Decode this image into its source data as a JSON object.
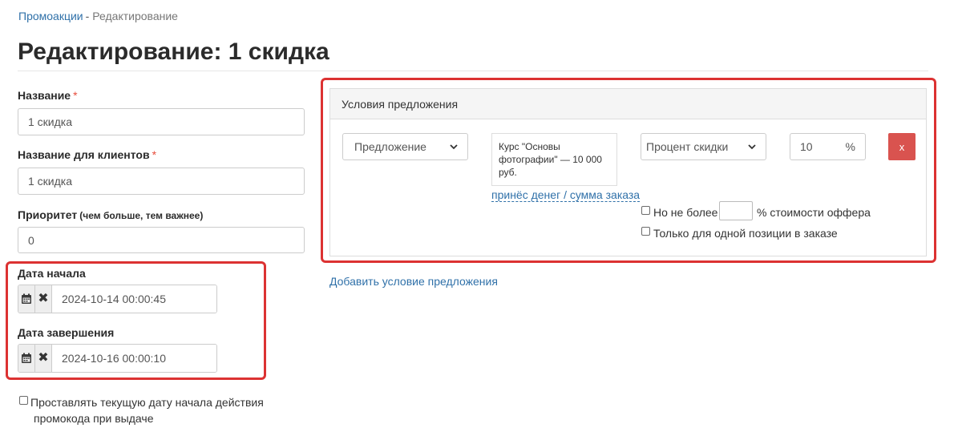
{
  "breadcrumb": {
    "link": "Промоакции",
    "separator": "-",
    "current": "Редактирование"
  },
  "page_title": "Редактирование: 1 скидка",
  "form": {
    "name": {
      "label": "Название",
      "required_mark": "*",
      "value": "1 скидка"
    },
    "client_name": {
      "label": "Название для клиентов",
      "required_mark": "*",
      "value": "1 скидка"
    },
    "priority": {
      "label": "Приоритет",
      "hint": "(чем больше, тем важнее)",
      "value": "0"
    },
    "start_date": {
      "label": "Дата начала",
      "value": "2024-10-14 00:00:45"
    },
    "end_date": {
      "label": "Дата завершения",
      "value": "2024-10-16 00:00:10"
    },
    "auto_start": {
      "line1": "Проставлять текущую дату начала действия",
      "line2": "промокода при выдаче",
      "checked": false
    }
  },
  "conditions": {
    "title": "Условия предложения",
    "offer_select": "Предложение",
    "offer_card": "Курс \"Основы фотографии\" — 10 000 руб.",
    "metric_link": "принёс денег / сумма заказа",
    "discount_type_select": "Процент скидки",
    "discount_value": "10",
    "discount_unit": "%",
    "remove_label": "x",
    "max_prefix": "Но не более",
    "max_suffix": "% стоимости оффера",
    "single_position": "Только для одной позиции в заказе"
  },
  "add_condition_link": "Добавить условие предложения",
  "colors": {
    "link": "#3071a9",
    "highlight": "#dc3232",
    "danger": "#d9534f",
    "required": "#e74c3c"
  },
  "icons": [
    "calendar-icon",
    "clear-icon",
    "chevron-down-icon"
  ]
}
